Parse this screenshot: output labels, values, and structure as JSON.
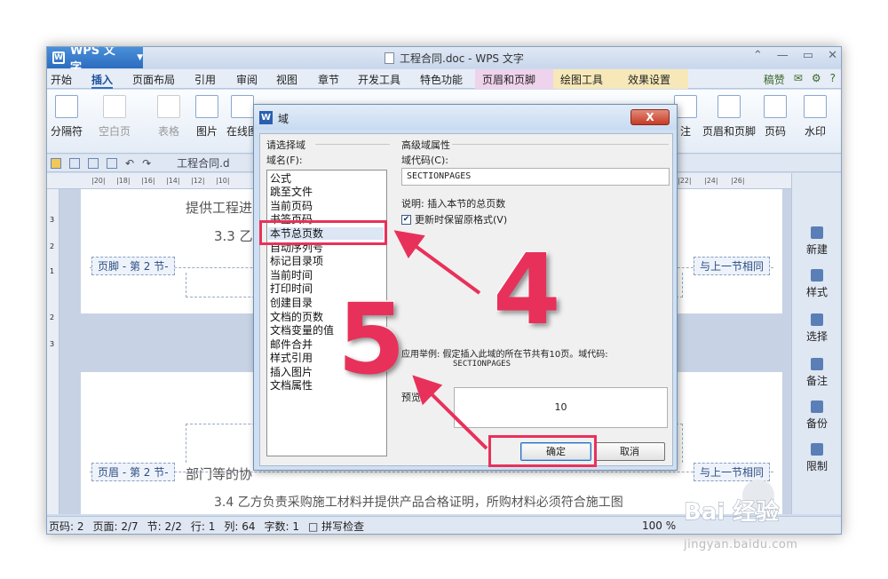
{
  "app": {
    "name": "WPS 文字",
    "doc_title": "工程合同.doc - WPS 文字"
  },
  "menu": {
    "tabs": [
      "开始",
      "插入",
      "页面布局",
      "引用",
      "审阅",
      "视图",
      "章节",
      "开发工具",
      "特色功能",
      "页眉和页脚",
      "绘图工具",
      "效果设置"
    ],
    "active_tab": "插入",
    "right_label": "稿赞"
  },
  "ribbon": {
    "page_break": "分隔符",
    "blank_page": "空白页",
    "table": "表格",
    "picture": "图片",
    "online": "在线图",
    "header_footer": "页眉和页脚",
    "page_number": "页码",
    "watermark": "水印",
    "partial": "注"
  },
  "toolbar": {
    "doc_tab": "工程合同.d"
  },
  "ruler": {
    "ticks": [
      "|20|",
      "|18|",
      "|16|",
      "|14|",
      "|12|",
      "|10|",
      "|22|",
      "|24|",
      "|26|"
    ]
  },
  "document": {
    "line1": "提供工程进",
    "line2": "3.3 乙",
    "footer_label": "页脚 - 第 2 节-",
    "same_as_prev": "与上一节相同",
    "header_label": "页眉 - 第 2 节-",
    "line3": "部门等的协",
    "line4": "3.4 乙方负责采购施工材料并提供产品合格证明，所购材料必须符合施工图",
    "vruler": [
      "3",
      "2",
      "1",
      "2",
      "3"
    ]
  },
  "taskpane": {
    "items": [
      "新建",
      "样式",
      "选择",
      "备注",
      "备份",
      "限制"
    ]
  },
  "statusbar": {
    "page": "页码: 2",
    "pages": "页面: 2/7",
    "section": "节: 2/2",
    "row": "行: 1",
    "col": "列: 64",
    "words": "字数: 1",
    "spell": "拼写检查",
    "zoom": "100 %"
  },
  "dialog": {
    "title": "域",
    "close": "X",
    "choose_field": "请选择域",
    "field_name_label": "域名(F):",
    "fields": [
      "公式",
      "跳至文件",
      "当前页码",
      "书签页码",
      "本节总页数",
      "自动序列号",
      "标记目录项",
      "当前时间",
      "打印时间",
      "创建目录",
      "文档的页数",
      "文档变量的值",
      "邮件合并",
      "样式引用",
      "插入图片",
      "文档属性"
    ],
    "selected_field": "本节总页数",
    "adv_props": "高级域属性",
    "code_label": "域代码(C):",
    "code_value": "SECTIONPAGES",
    "description": "说明: 插入本节的总页数",
    "keep_format": "更新时保留原格式(V)",
    "example_text": "应用举例: 假定插入此域的所在节共有10页。域代码:",
    "example_code": "SECTIONPAGES",
    "preview_label": "预览:",
    "preview_value": "10",
    "ok": "确定",
    "cancel": "取消"
  },
  "annotations": {
    "step4": "4",
    "step5": "5",
    "color": "#e8315a"
  },
  "watermark": {
    "logo": "Bai 经验",
    "url": "jingyan.baidu.com"
  }
}
